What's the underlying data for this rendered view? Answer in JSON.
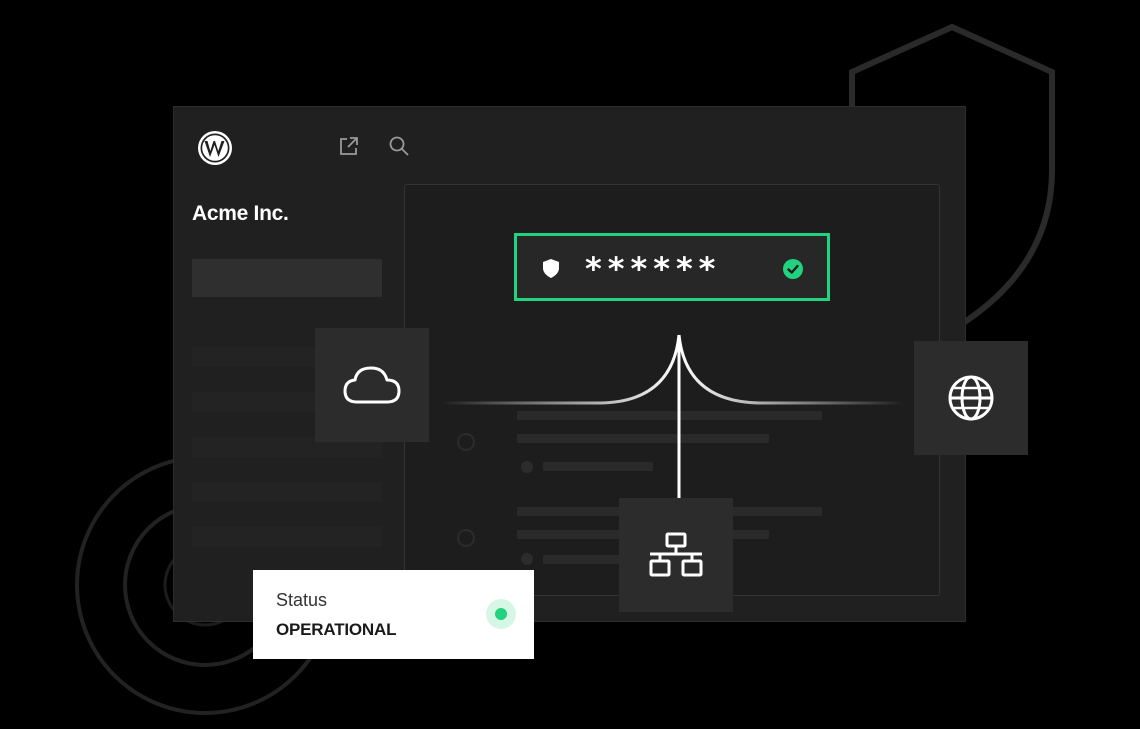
{
  "site": {
    "name": "Acme Inc."
  },
  "password_field": {
    "masked_value": "******",
    "status": "verified"
  },
  "status_card": {
    "label": "Status",
    "value": "OPERATIONAL"
  },
  "icons": {
    "logo": "wordpress-logo-icon",
    "external": "external-link-icon",
    "search": "search-icon",
    "field_left": "shield-icon",
    "field_right": "check-circle-icon",
    "tile_left": "cloud-icon",
    "tile_right": "globe-icon",
    "tile_bottom": "network-icon",
    "background": "shield-outline-icon"
  },
  "colors": {
    "accent": "#21d37f",
    "background": "#000000",
    "window": "#202020",
    "tile": "#2c2c2c",
    "card": "#ffffff"
  }
}
